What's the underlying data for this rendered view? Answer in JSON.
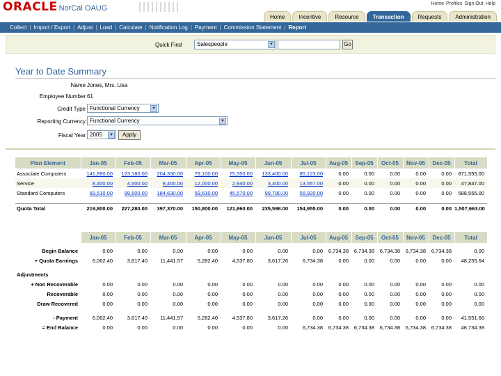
{
  "header": {
    "logo_text": "ORACLE",
    "app_name": "NorCal OAUG",
    "global_links": [
      "Home",
      "Profiles",
      "Sign Out",
      "Help"
    ],
    "tabs": [
      "Home",
      "Incentive",
      "Resource",
      "Transaction",
      "Requests",
      "Administration"
    ],
    "active_tab": "Transaction"
  },
  "subnav": {
    "items": [
      "Collect",
      "Import / Export",
      "Adjust",
      "Load",
      "Calculate",
      "Notification Log",
      "Payment",
      "Commission Statement",
      "Report"
    ],
    "active": "Report"
  },
  "quickfind": {
    "label": "Quick Find",
    "selected": "Salespeople",
    "value": "",
    "go_label": "Go"
  },
  "page": {
    "title": "Year to Date Summary"
  },
  "form": {
    "name_label": "Name",
    "name_value": "Jones, Mrs. Lisa",
    "employee_label": "Employee Number",
    "employee_value": "61",
    "credit_label": "Credit Type",
    "credit_value": "Functional Currency",
    "currency_label": "Reporting Currency",
    "currency_value": "Functional Currency",
    "fiscal_label": "Fiscal Year",
    "fiscal_value": "2005",
    "apply_label": "Apply"
  },
  "months": [
    "Jan-05",
    "Feb-05",
    "Mar-05",
    "Apr-05",
    "May-05",
    "Jun-05",
    "Jul-05",
    "Aug-05",
    "Sep-05",
    "Oct-05",
    "Nov-05",
    "Dec-05"
  ],
  "quota_table": {
    "first_header": "Plan Element",
    "total_header": "Total",
    "rows": [
      {
        "label": "Associate Computers",
        "values": [
          "141,890.00",
          "123,180.00",
          "204,330.00",
          "79,100.00",
          "75,350.00",
          "133,400.00",
          "85,123.00",
          "0.00",
          "0.00",
          "0.00",
          "0.00",
          "0.00"
        ],
        "total": "871,555.00"
      },
      {
        "label": "Service",
        "values": [
          "8,400.00",
          "4,500.00",
          "8,400.00",
          "12,000.00",
          "2,940.00",
          "3,400.00",
          "13,557.00",
          "0.00",
          "0.00",
          "0.00",
          "0.00",
          "0.00"
        ],
        "total": "47,847.00"
      },
      {
        "label": "Standard Computers",
        "values": [
          "69,510.00",
          "99,600.00",
          "184,630.00",
          "59,610.00",
          "45,570.00",
          "99,780.00",
          "56,920.00",
          "0.00",
          "0.00",
          "0.00",
          "0.00",
          "0.00"
        ],
        "total": "588,555.00"
      }
    ],
    "total_row": {
      "label": "Quota Total",
      "values": [
        "219,800.00",
        "227,280.00",
        "397,370.00",
        "150,800.00",
        "121,860.00",
        "235,598.00",
        "154,955.00",
        "0.00",
        "0.00",
        "0.00",
        "0.00",
        "0.00"
      ],
      "total": "1,507,663.00"
    }
  },
  "balance_table": {
    "total_header": "Total",
    "rows": [
      {
        "label": "Begin Balance",
        "values": [
          "0.00",
          "0.00",
          "0.00",
          "0.00",
          "0.00",
          "0.00",
          "0.00",
          "6,734.38",
          "6,734.38",
          "6,734.38",
          "6,734.38",
          "6,734.38"
        ],
        "total": "0.00"
      },
      {
        "label": "+ Quota Earnings",
        "values": [
          "6,062.40",
          "3,617.40",
          "11,441.57",
          "5,282.40",
          "4,537.80",
          "3,617.26",
          "6,734.38",
          "0.00",
          "0.00",
          "0.00",
          "0.00",
          "0.00"
        ],
        "total": "48,255.64"
      }
    ],
    "adjustments_label": "Adjustments",
    "adjust_rows": [
      {
        "label": "+ Non Recoverable",
        "values": [
          "0.00",
          "0.00",
          "0.00",
          "0.00",
          "0.00",
          "0.00",
          "0.00",
          "0.00",
          "0.00",
          "0.00",
          "0.00",
          "0.00"
        ],
        "total": "0.00"
      },
      {
        "label": "Recoverable",
        "values": [
          "0.00",
          "0.00",
          "0.00",
          "0.00",
          "0.00",
          "0.00",
          "0.00",
          "0.00",
          "0.00",
          "0.00",
          "0.00",
          "0.00"
        ],
        "total": "0.00"
      },
      {
        "label": "Draw Recovered",
        "values": [
          "0.00",
          "0.00",
          "0.00",
          "0.00",
          "0.00",
          "0.00",
          "0.00",
          "0.00",
          "0.00",
          "0.00",
          "0.00",
          "0.00"
        ],
        "total": "0.00"
      }
    ],
    "end_rows": [
      {
        "label": "- Payment",
        "values": [
          "6,062.40",
          "3,617.40",
          "11,441.57",
          "5,282.40",
          "4,537.80",
          "3,617.26",
          "0.00",
          "0.00",
          "0.00",
          "0.00",
          "0.00",
          "0.00"
        ],
        "total": "41,551.66"
      },
      {
        "label": "= End Balance",
        "values": [
          "0.00",
          "0.00",
          "0.00",
          "0.00",
          "0.00",
          "0.00",
          "6,734.38",
          "6,734.38",
          "6,734.38",
          "6,734.38",
          "6,734.38",
          "6,734.38"
        ],
        "total": "46,734.38"
      }
    ]
  }
}
